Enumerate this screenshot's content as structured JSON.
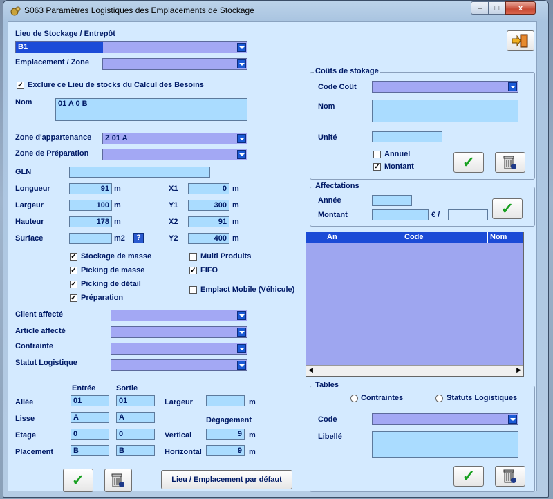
{
  "window": {
    "title": "S063 Paramètres Logistiques des Emplacements de Stockage",
    "minimize": "–",
    "maximize": "□",
    "close": "x"
  },
  "left": {
    "lieu_label": "Lieu de Stockage / Entrepôt",
    "lieu_value": "B1",
    "emplacement_label": "Emplacement / Zone",
    "exclure_label": "Exclure ce Lieu de stocks du Calcul des Besoins",
    "exclure_checked": true,
    "nom_label": "Nom",
    "nom_value": "01 A 0 B",
    "zone_app_label": "Zone d'appartenance",
    "zone_app_value": "Z 01 A",
    "zone_prep_label": "Zone de Préparation",
    "gln_label": "GLN",
    "longueur_label": "Longueur",
    "longueur_value": "91",
    "longueur_unit": "m",
    "largeur_label": "Largeur",
    "largeur_value": "100",
    "largeur_unit": "m",
    "hauteur_label": "Hauteur",
    "hauteur_value": "178",
    "hauteur_unit": "m",
    "surface_label": "Surface",
    "surface_unit": "m2",
    "help_label": "?",
    "x1_label": "X1",
    "x1_value": "0",
    "x1_unit": "m",
    "y1_label": "Y1",
    "y1_value": "300",
    "y1_unit": "m",
    "x2_label": "X2",
    "x2_value": "91",
    "x2_unit": "m",
    "y2_label": "Y2",
    "y2_value": "400",
    "y2_unit": "m",
    "stockage_masse": "Stockage de masse",
    "picking_masse": "Picking de masse",
    "picking_detail": "Picking de détail",
    "preparation": "Préparation",
    "multi_produits": "Multi Produits",
    "fifo": "FIFO",
    "emplact_mobile": "Emplact Mobile (Véhicule)",
    "client_label": "Client affecté",
    "article_label": "Article affecté",
    "contrainte_label": "Contrainte",
    "statut_label": "Statut Logistique",
    "entree_header": "Entrée",
    "sortie_header": "Sortie",
    "allee_label": "Allée",
    "allee_in": "01",
    "allee_out": "01",
    "lisse_label": "Lisse",
    "lisse_in": "A",
    "lisse_out": "A",
    "etage_label": "Etage",
    "etage_in": "0",
    "etage_out": "0",
    "placement_label": "Placement",
    "placement_in": "B",
    "placement_out": "B",
    "largeur2_label": "Largeur",
    "largeur2_unit": "m",
    "degagement_label": "Dégagement",
    "vertical_label": "Vertical",
    "vertical_value": "9",
    "vertical_unit": "m",
    "horizontal_label": "Horizontal",
    "horizontal_value": "9",
    "horizontal_unit": "m",
    "defaut_button": "Lieu / Emplacement par défaut",
    "check_mark": "✓"
  },
  "couts": {
    "caption": "Coûts de stokage",
    "code_label": "Code Coût",
    "nom_label": "Nom",
    "unite_label": "Unité",
    "annuel_label": "Annuel",
    "montant_label": "Montant"
  },
  "affect": {
    "caption": "Affectations",
    "annee_label": "Année",
    "montant_label": "Montant",
    "currency": "€ /"
  },
  "grid": {
    "columns": [
      "An",
      "Code",
      "Nom"
    ],
    "scroll_left": "◀",
    "scroll_right": "▶"
  },
  "tables": {
    "caption": "Tables",
    "radio1": "Contraintes",
    "radio2": "Statuts Logistiques",
    "code_label": "Code",
    "libelle_label": "Libellé"
  }
}
